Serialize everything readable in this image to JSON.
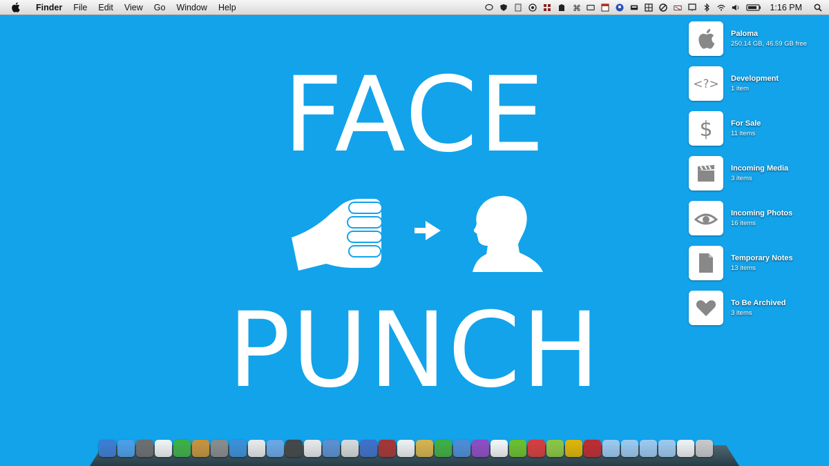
{
  "menubar": {
    "app_name": "Finder",
    "menus": [
      "File",
      "Edit",
      "View",
      "Go",
      "Window",
      "Help"
    ],
    "clock": "1:16 PM",
    "status_icons": [
      "chat-icon",
      "shield-icon",
      "script-icon",
      "aperture-icon",
      "grid-icon",
      "evernote-icon",
      "command-icon",
      "camera-icon",
      "calendar-icon",
      "user-icon",
      "keyboard-icon",
      "grid-icon",
      "timer-icon",
      "antenna-icon",
      "display-icon",
      "bluetooth-icon",
      "wifi-icon",
      "volume-icon",
      "battery-icon",
      "spotlight-icon"
    ]
  },
  "wallpaper": {
    "top_word": "FACE",
    "bottom_word": "PUNCH",
    "color": "#12a3ea"
  },
  "desktop_items": [
    {
      "name": "Paloma",
      "detail": "250.14 GB, 46.59 GB free",
      "icon": "apple-icon"
    },
    {
      "name": "Development",
      "detail": "1 item",
      "icon": "code-icon"
    },
    {
      "name": "For Sale",
      "detail": "11 items",
      "icon": "dollar-icon"
    },
    {
      "name": "Incoming Media",
      "detail": "3 items",
      "icon": "clapperboard-icon"
    },
    {
      "name": "Incoming Photos",
      "detail": "16 items",
      "icon": "eye-icon"
    },
    {
      "name": "Temporary Notes",
      "detail": "13 items",
      "icon": "text-file-icon"
    },
    {
      "name": "To Be Archived",
      "detail": "3 items",
      "icon": "heart-icon"
    }
  ],
  "dock": {
    "icons": [
      {
        "name": "finder-icon",
        "color": "#3b7bd4"
      },
      {
        "name": "safari-icon",
        "color": "#4a9ee8"
      },
      {
        "name": "mission-control-icon",
        "color": "#6d6d6d"
      },
      {
        "name": "calendar-icon",
        "color": "#f2f2f2"
      },
      {
        "name": "downloads-icon",
        "color": "#3cb043"
      },
      {
        "name": "box-icon",
        "color": "#c8923a"
      },
      {
        "name": "facetime-icon",
        "color": "#8a8a8a"
      },
      {
        "name": "twitter-icon",
        "color": "#3a8fd8"
      },
      {
        "name": "airmail-icon",
        "color": "#e9e9e9"
      },
      {
        "name": "video-icon",
        "color": "#6aa7e6"
      },
      {
        "name": "app-icon",
        "color": "#444444"
      },
      {
        "name": "chrome-icon",
        "color": "#e8e8e8"
      },
      {
        "name": "itunes-icon",
        "color": "#5a8fd0"
      },
      {
        "name": "photos-icon",
        "color": "#d9d9d9"
      },
      {
        "name": "pencil-icon",
        "color": "#3d6fc8"
      },
      {
        "name": "dictionary-icon",
        "color": "#a73232"
      },
      {
        "name": "preview-icon",
        "color": "#efefef"
      },
      {
        "name": "books-icon",
        "color": "#d6b24a"
      },
      {
        "name": "leaf-icon",
        "color": "#3fae3f"
      },
      {
        "name": "xcode-icon",
        "color": "#4c8cd6"
      },
      {
        "name": "game-icon",
        "color": "#8f4ac2"
      },
      {
        "name": "notes-icon",
        "color": "#f5f5f5"
      },
      {
        "name": "evernote-icon",
        "color": "#6bbf2a"
      },
      {
        "name": "cube-icon",
        "color": "#d93a3a"
      },
      {
        "name": "stack-icon",
        "color": "#8dc63f"
      },
      {
        "name": "stripes-icon",
        "color": "#e0b400"
      },
      {
        "name": "monitor-icon",
        "color": "#c0282d"
      },
      {
        "name": "folder-icon",
        "color": "#9cc8ee"
      },
      {
        "name": "folder-icon",
        "color": "#9cc8ee"
      },
      {
        "name": "folder-icon",
        "color": "#9cc8ee"
      },
      {
        "name": "folder-icon",
        "color": "#9cc8ee"
      },
      {
        "name": "notes-stack-icon",
        "color": "#f0f0f0"
      },
      {
        "name": "trash-icon",
        "color": "#c8c8c8"
      }
    ]
  }
}
